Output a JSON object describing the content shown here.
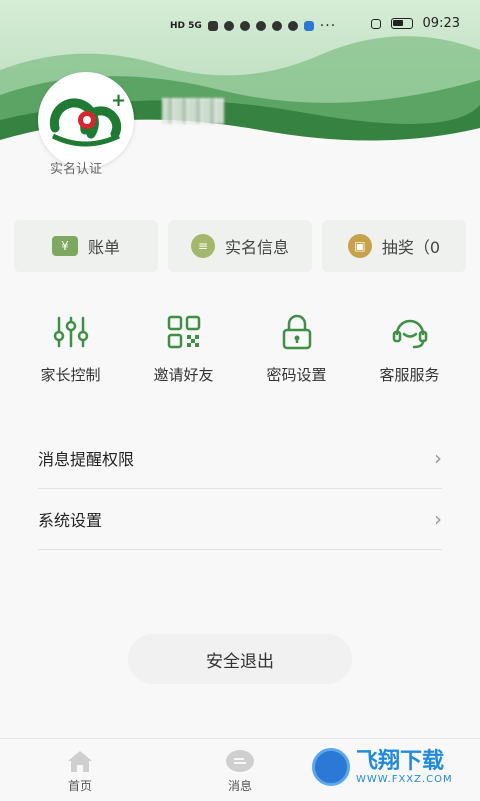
{
  "status_bar": {
    "network": "HD 5G",
    "time": "09:23",
    "more": "···"
  },
  "profile": {
    "verify_label": "实名认证"
  },
  "quick_actions": [
    {
      "label": "账单",
      "icon": "bill-icon"
    },
    {
      "label": "实名信息",
      "icon": "id-card-icon"
    },
    {
      "label": "抽奖（0",
      "icon": "gift-icon"
    }
  ],
  "features": [
    {
      "label": "家长控制",
      "icon": "sliders-icon"
    },
    {
      "label": "邀请好友",
      "icon": "qr-code-icon"
    },
    {
      "label": "密码设置",
      "icon": "lock-icon"
    },
    {
      "label": "客服服务",
      "icon": "headset-icon"
    }
  ],
  "settings": [
    {
      "label": "消息提醒权限"
    },
    {
      "label": "系统设置"
    }
  ],
  "logout_label": "安全退出",
  "tabs": [
    {
      "label": "首页",
      "icon": "home-icon"
    },
    {
      "label": "消息",
      "icon": "message-icon"
    }
  ],
  "watermark": {
    "title": "飞翔下载",
    "url": "WWW.FXXZ.COM"
  },
  "colors": {
    "accent_green": "#3f8f45",
    "logo_red": "#d9262c"
  }
}
